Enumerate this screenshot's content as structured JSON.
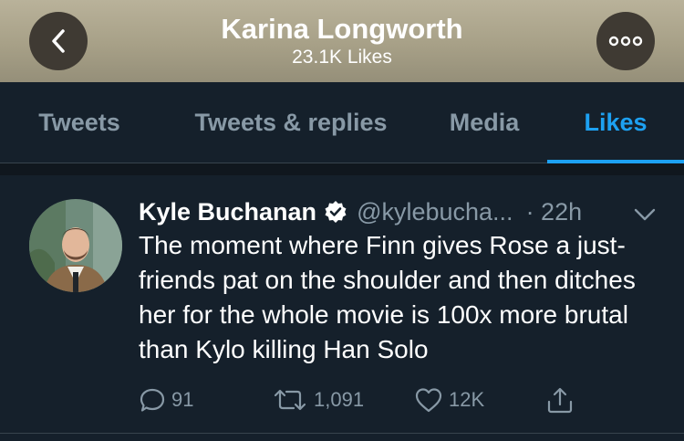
{
  "header": {
    "title": "Karina Longworth",
    "subtitle": "23.1K Likes",
    "back_icon": "chevron-left-icon",
    "more_icon": "more-horizontal-icon",
    "background_color": "#a9a28a"
  },
  "tabs": [
    {
      "label": "Tweets",
      "active": false
    },
    {
      "label": "Tweets & replies",
      "active": false
    },
    {
      "label": "Media",
      "active": false
    },
    {
      "label": "Likes",
      "active": true
    }
  ],
  "tweet": {
    "author_name": "Kyle Buchanan",
    "verified": true,
    "handle": "@kylebucha...",
    "time": "· 22h",
    "text": "The moment where Finn gives Rose a just-friends pat on the shoulder and then ditches her for the whole movie is 100x more brutal than Kylo killing Han Solo",
    "actions": {
      "reply_count": "91",
      "retweet_count": "1,091",
      "like_count": "12K"
    }
  },
  "colors": {
    "background": "#15202b",
    "accent": "#1da1f2",
    "muted_text": "#8899a6",
    "divider": "#38444d"
  }
}
